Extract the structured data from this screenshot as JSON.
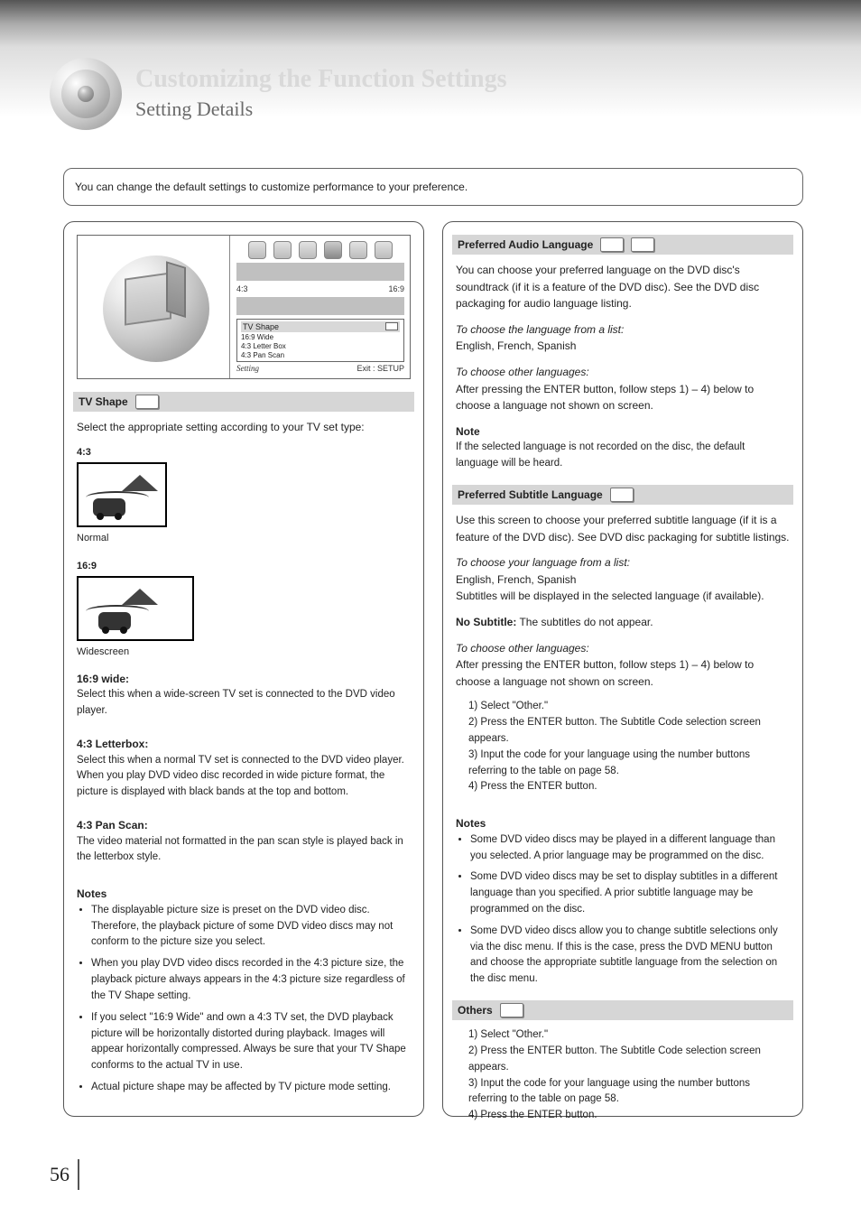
{
  "page": {
    "number": "56",
    "title_main": "Customizing the Function Settings",
    "title_sub": "Setting Details",
    "intro": "You can change the default settings to customize performance to your preference."
  },
  "setting_panel": {
    "nav_icons": [
      "nav-1",
      "nav-2",
      "nav-3",
      "nav-4",
      "nav-5",
      "nav-6"
    ],
    "top_label_left": "4:3",
    "top_label_right": "16:9",
    "framed_title": "TV Shape",
    "framed_items": [
      "16:9 Wide",
      "4:3 Letter Box",
      "4:3 Pan Scan"
    ],
    "footer_left": "Setting",
    "footer_right": "Exit : SETUP"
  },
  "left": {
    "bar_prefix": "TV Shape",
    "thumb_normal_label": "4:3",
    "thumb_normal_caption": "Normal",
    "thumb_wide_label": "16:9",
    "thumb_wide_caption": "Widescreen",
    "para1": "Select the appropriate setting according to your TV set type:",
    "opts": [
      {
        "name": "16:9 wide:",
        "desc": "Select this when a wide-screen TV set is connected to the DVD video player."
      },
      {
        "name": "4:3 Letterbox:",
        "desc": "Select this when a normal TV set is connected to the DVD video player. When you play DVD video disc recorded in wide picture format, the picture is displayed with black bands at the top and bottom."
      },
      {
        "name": "4:3 Pan Scan:",
        "desc": "The video material not formatted in the pan scan style is played back in the letterbox style."
      }
    ],
    "notes_heading": "Notes",
    "notes": [
      "The displayable picture size is preset on the DVD video disc. Therefore, the playback picture of some DVD video discs may not conform to the picture size you select.",
      "When you play DVD video discs recorded in the 4:3 picture size, the playback picture always appears in the 4:3 picture size regardless of the TV Shape setting.",
      "If you select \"16:9 Wide\" and own a 4:3 TV set, the DVD playback picture will be horizontally distorted during playback. Images will appear horizontally compressed. Always be sure that your TV Shape conforms to the actual TV in use.",
      "Actual picture shape may be affected by TV picture mode setting."
    ]
  },
  "right": {
    "a": {
      "bar_prefix": "Preferred Audio Language",
      "para1": "You can choose your preferred language on the DVD disc's soundtrack (if it is a feature of the DVD disc). See the DVD disc packaging for audio language listing.",
      "para2_lead": "To choose the language from a list:",
      "para2_lang_list": "English, French, Spanish",
      "para3_lead": "To choose other languages:",
      "para3_body": "After pressing the ENTER button, follow steps 1) – 4) below to choose a language not shown on screen.",
      "note_heading": "Note",
      "note": "If the selected language is not recorded on the disc, the default language will be heard."
    },
    "b": {
      "bar_prefix": "Preferred Subtitle Language",
      "para1": "Use this screen to choose your preferred subtitle language (if it is a feature of the DVD disc). See DVD disc packaging for subtitle listings.",
      "para2_lead": "To choose your language from a list:",
      "para2_lang_list": "English, French, Spanish",
      "para2_tail": "Subtitles will be displayed in the selected language (if available).",
      "no_subtitle_label": "No Subtitle:",
      "no_subtitle_desc": "The subtitles do not appear.",
      "para3_lead": "To choose other languages:",
      "para3_body": "After pressing the ENTER button, follow steps 1) – 4) below to choose a language not shown on screen.",
      "steps": [
        "Select \"Other.\"",
        "Press the ENTER button. The Subtitle Code selection screen appears.",
        "Input the code for your language using the number buttons referring to the table on page",
        "Press the ENTER button."
      ],
      "ref_page": "58",
      "notes_heading": "Notes",
      "notes": [
        "Some DVD video discs may be played in a different language than you selected. A prior language may be programmed on the disc.",
        "Some DVD video discs may be set to display subtitles in a different language than you specified. A prior subtitle language may be programmed on the disc.",
        "Some DVD video discs allow you to change subtitle selections only via the disc menu. If this is the case, press the DVD MENU button and choose the appropriate subtitle language from the selection on the disc menu."
      ]
    },
    "c": {
      "bar_prefix": "Others",
      "steps": [
        "Select \"Other.\"",
        "Press the ENTER button. The Subtitle Code selection screen appears.",
        "Input the code for your language using the number buttons referring to the table on page",
        "Press the ENTER button."
      ],
      "ref_page": "58"
    }
  }
}
